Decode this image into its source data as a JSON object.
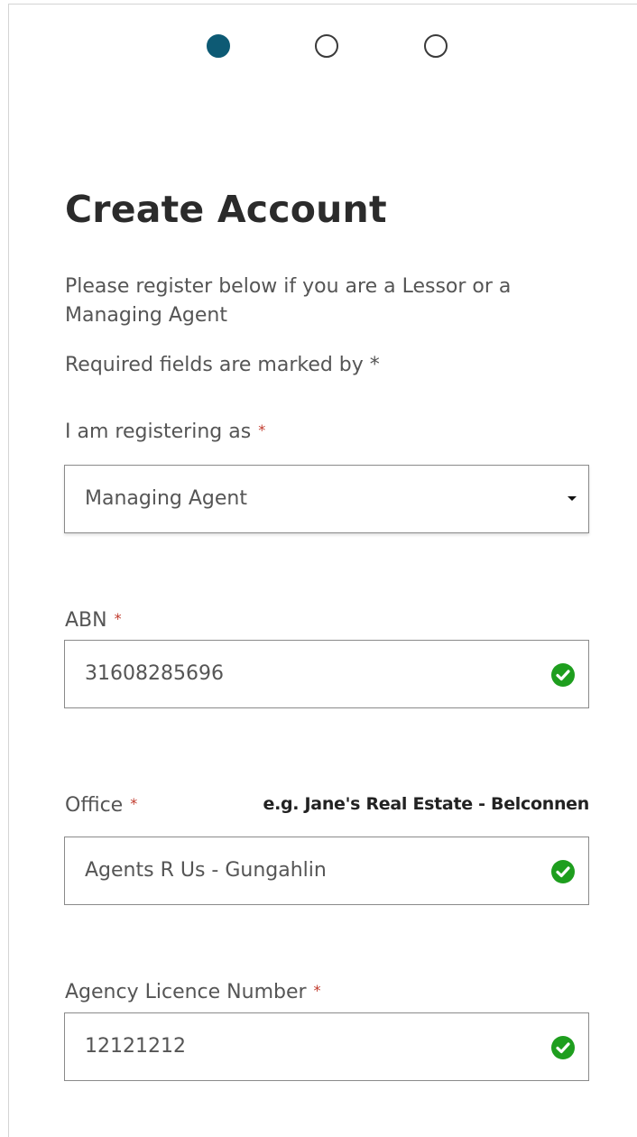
{
  "progress": {
    "steps": [
      {
        "state": "active"
      },
      {
        "state": "inactive"
      },
      {
        "state": "inactive"
      }
    ],
    "active_color": "#0d5a74"
  },
  "form": {
    "title": "Create Account",
    "intro": "Please register below if you are a Lessor or a Managing Agent",
    "required_note": "Required fields are marked by *",
    "required_marker": "*",
    "registering_as": {
      "label": "I am registering as",
      "selected": "Managing Agent"
    },
    "abn": {
      "label": "ABN",
      "value": "31608285696",
      "valid": true
    },
    "office": {
      "label": "Office",
      "hint": "e.g. Jane's Real Estate - Belconnen",
      "value": "Agents R Us - Gungahlin",
      "valid": true
    },
    "licence": {
      "label": "Agency Licence Number",
      "value": "12121212",
      "valid": true
    }
  },
  "colors": {
    "valid_check": "#1e9e1e",
    "required_star": "#c0392b"
  },
  "icons": {
    "valid": "check-circle-icon",
    "dropdown": "caret-down-icon"
  }
}
